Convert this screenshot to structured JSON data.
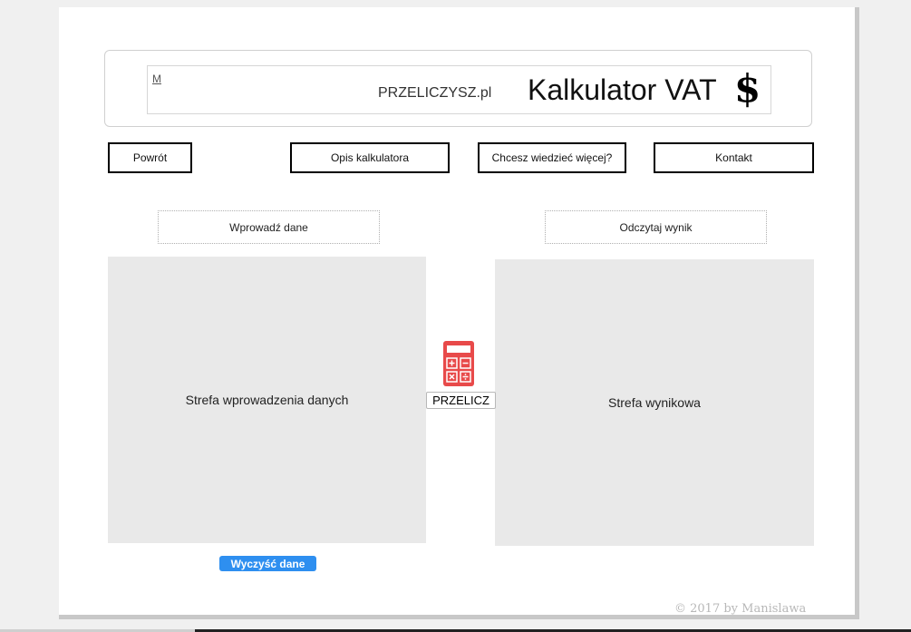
{
  "header": {
    "brand_mark": "M",
    "site_name": "PRZELICZYSZ.pl",
    "app_title": "Kalkulator VAT",
    "title_icon": "dollar-sign-icon"
  },
  "nav": {
    "back_label": "Powrót",
    "description_label": "Opis kalkulatora",
    "more_label": "Chcesz wiedzieć więcej?",
    "contact_label": "Kontakt"
  },
  "input_section": {
    "heading": "Wprowadź dane",
    "zone_text": "Strefa wprowadzenia danych",
    "clear_label": "Wyczyść dane"
  },
  "output_section": {
    "heading": "Odczytaj wynik",
    "zone_text": "Strefa wynikowa"
  },
  "calculate": {
    "icon": "calculator-icon",
    "label": "PRZELICZ"
  },
  "footer": {
    "text": "© 2017 by Manislawa"
  },
  "colors": {
    "calculator_icon": "#e84a4a",
    "clear_button": "#2e8ff0",
    "zone_background": "#e9e9e9"
  }
}
